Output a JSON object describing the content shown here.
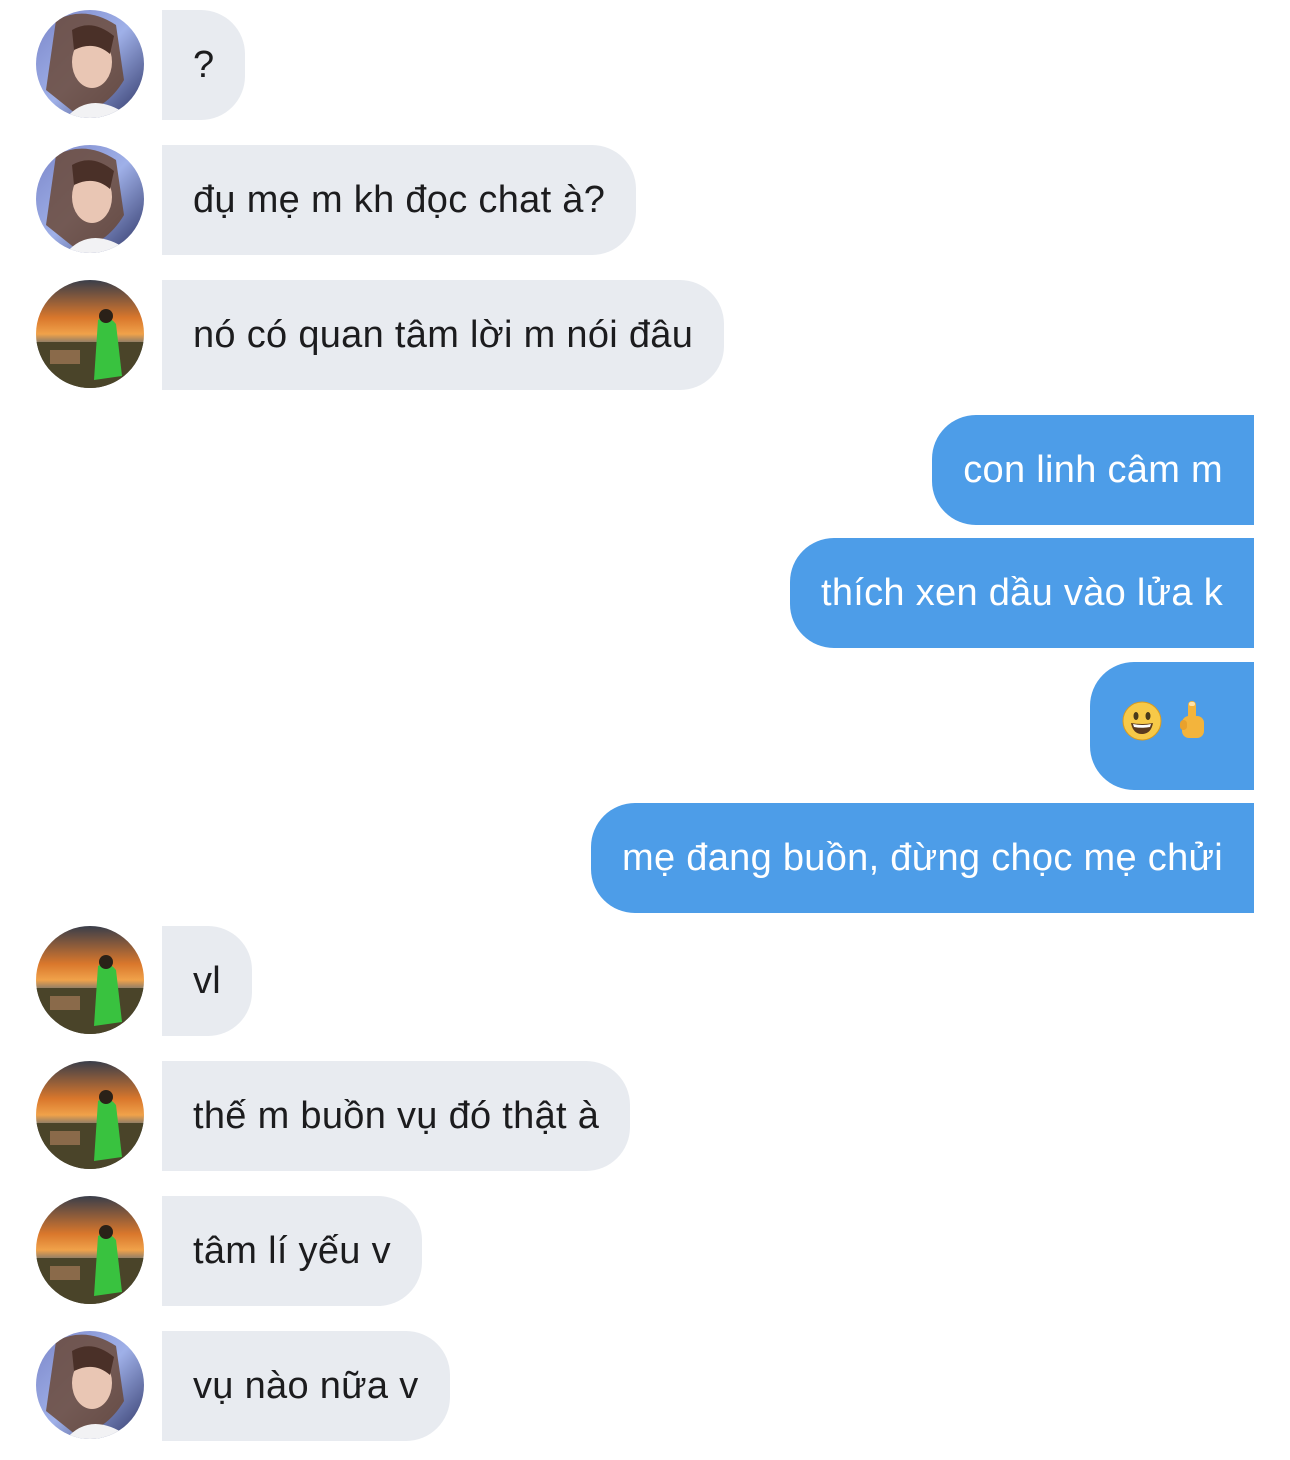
{
  "messages": [
    {
      "side": "in",
      "avatar": "girl",
      "text": "?"
    },
    {
      "side": "in",
      "avatar": "girl",
      "text": "đụ mẹ m kh đọc chat à?"
    },
    {
      "side": "in",
      "avatar": "sunset",
      "text": "nó có quan tâm lời m nói đâu"
    },
    {
      "side": "out",
      "text": "con linh câm m"
    },
    {
      "side": "out",
      "text": "thích xen dầu vào lửa k"
    },
    {
      "side": "out",
      "emoji": [
        "grinning-face-icon",
        "middle-finger-icon"
      ]
    },
    {
      "side": "out",
      "text": "mẹ đang buồn, đừng chọc mẹ chửi"
    },
    {
      "side": "in",
      "avatar": "sunset",
      "text": "vl"
    },
    {
      "side": "in",
      "avatar": "sunset",
      "text": "thế m buồn vụ đó thật à"
    },
    {
      "side": "in",
      "avatar": "sunset",
      "text": "tâm lí yếu v"
    },
    {
      "side": "in",
      "avatar": "girl",
      "text": "vụ nào nữa v"
    }
  ],
  "colors": {
    "incoming_bubble": "#e8ebf0",
    "outgoing_bubble": "#4d9de8",
    "incoming_text": "#1c1c1e",
    "outgoing_text": "#ffffff"
  }
}
